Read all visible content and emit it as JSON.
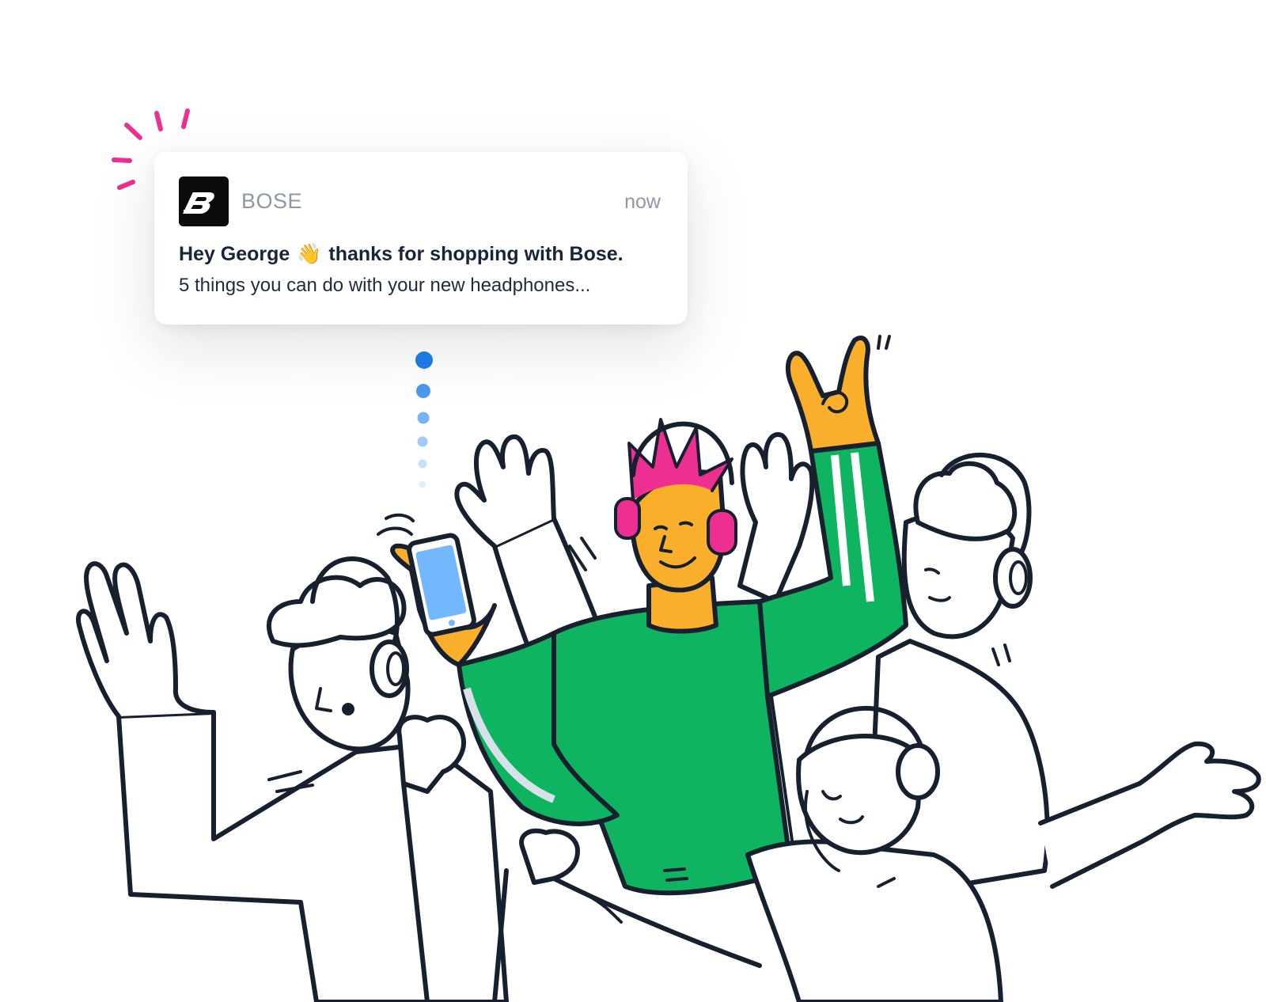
{
  "notification": {
    "app_name": "BOSE",
    "timestamp": "now",
    "title_part1": "Hey George",
    "emoji": "👋",
    "title_part2": "thanks for shopping with Bose.",
    "body": "5 things you can do with your new headphones..."
  },
  "colors": {
    "ink": "#17202f",
    "accent_pink": "#ec2f91",
    "shirt_green": "#0fb461",
    "skin_orange": "#f9ae2c",
    "phone_blue": "#73b8ff",
    "dot_blue": "#1f7ee8",
    "muted_text": "#8f98a6"
  },
  "icons": {
    "app_logo": "bose-logo-icon",
    "emoji": "waving-hand-icon"
  }
}
